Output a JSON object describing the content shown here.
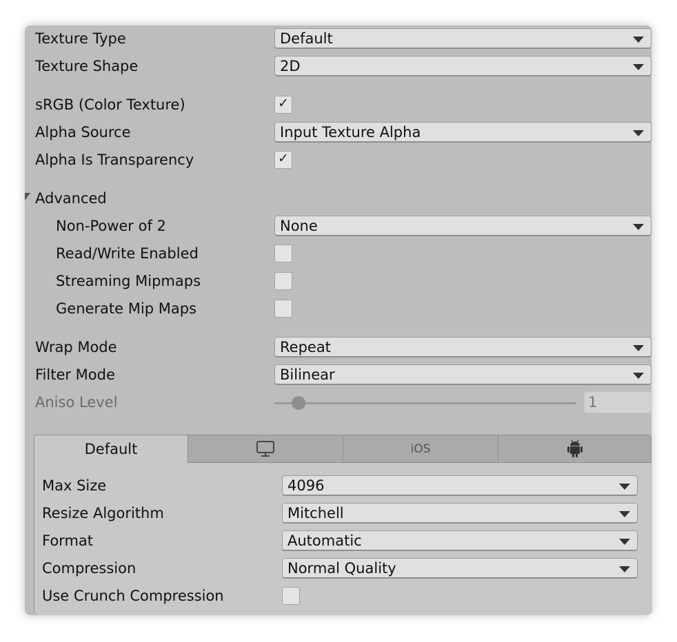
{
  "general": {
    "texture_type": {
      "label": "Texture Type",
      "value": "Default"
    },
    "texture_shape": {
      "label": "Texture Shape",
      "value": "2D"
    },
    "srgb": {
      "label": "sRGB (Color Texture)",
      "checked": true
    },
    "alpha_source": {
      "label": "Alpha Source",
      "value": "Input Texture Alpha"
    },
    "alpha_is_transparency": {
      "label": "Alpha Is Transparency",
      "checked": true
    }
  },
  "advanced": {
    "label": "Advanced",
    "expanded": true,
    "non_power_of_2": {
      "label": "Non-Power of 2",
      "value": "None"
    },
    "read_write": {
      "label": "Read/Write Enabled",
      "checked": false
    },
    "streaming_mipmaps": {
      "label": "Streaming Mipmaps",
      "checked": false
    },
    "generate_mip_maps": {
      "label": "Generate Mip Maps",
      "checked": false
    }
  },
  "sampling": {
    "wrap_mode": {
      "label": "Wrap Mode",
      "value": "Repeat"
    },
    "filter_mode": {
      "label": "Filter Mode",
      "value": "Bilinear"
    },
    "aniso_level": {
      "label": "Aniso Level",
      "value": "1",
      "slider_fraction": 0.0,
      "disabled": true
    }
  },
  "platform_tabs": [
    {
      "label": "Default",
      "active": true
    },
    {
      "label": "",
      "icon": "monitor-icon"
    },
    {
      "label": "iOS"
    },
    {
      "label": "",
      "icon": "android-icon"
    }
  ],
  "platform": {
    "max_size": {
      "label": "Max Size",
      "value": "4096"
    },
    "resize_algorithm": {
      "label": "Resize Algorithm",
      "value": "Mitchell"
    },
    "format": {
      "label": "Format",
      "value": "Automatic"
    },
    "compression": {
      "label": "Compression",
      "value": "Normal Quality"
    },
    "use_crunch": {
      "label": "Use Crunch Compression",
      "checked": false
    }
  },
  "check_glyph": "✓"
}
